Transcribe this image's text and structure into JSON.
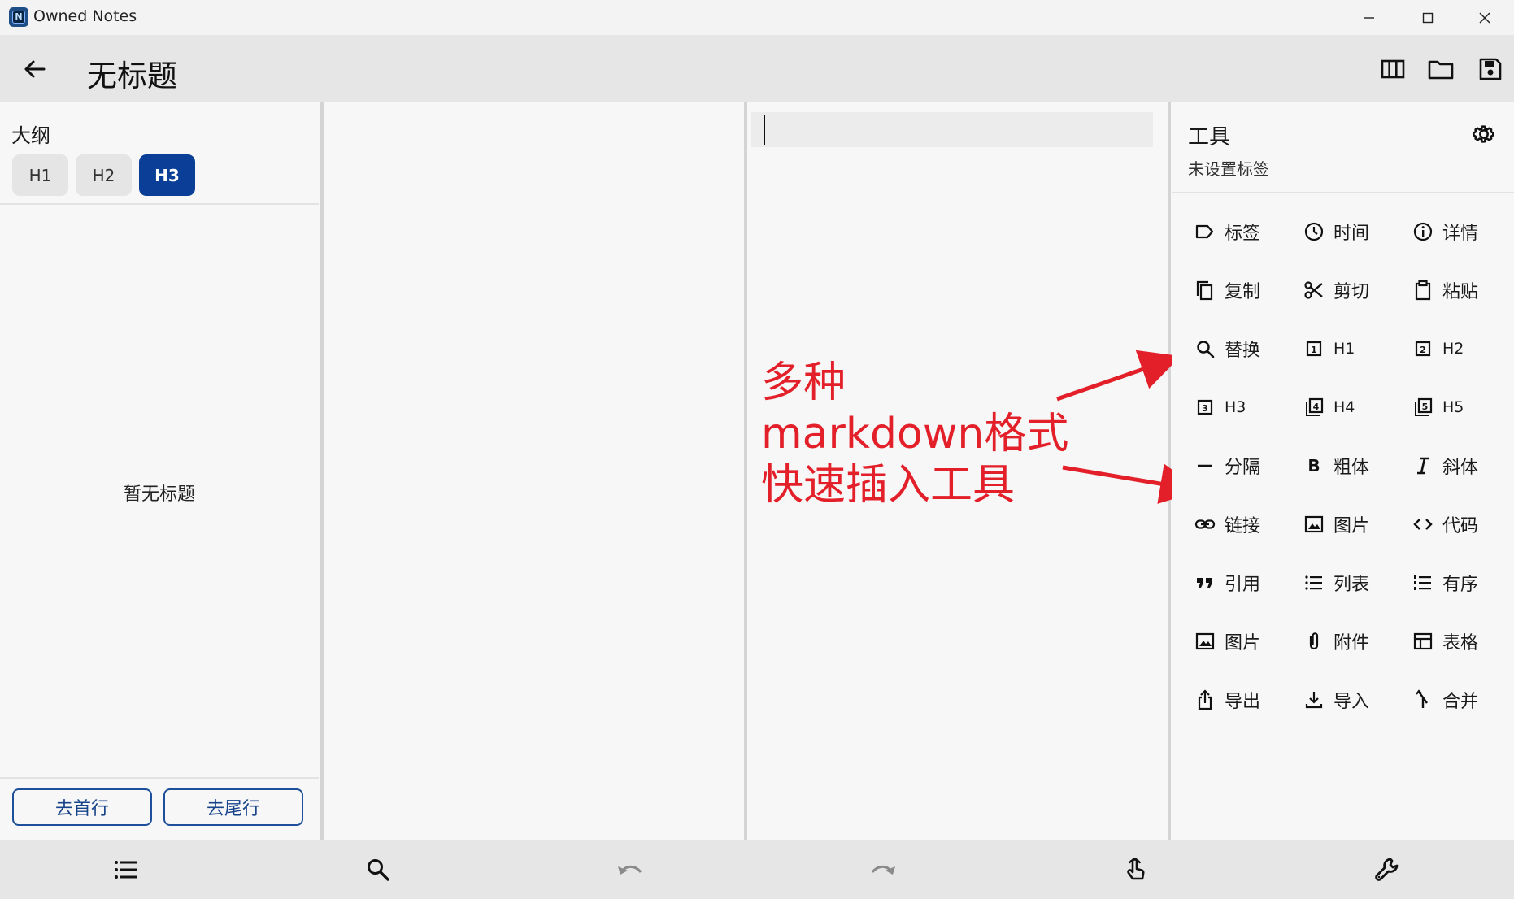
{
  "app": {
    "title": "Owned Notes",
    "logo_letter": "N"
  },
  "header": {
    "title": "无标题"
  },
  "outline": {
    "title": "大纲",
    "heading_buttons": [
      {
        "label": "H1",
        "active": false
      },
      {
        "label": "H2",
        "active": false
      },
      {
        "label": "H3",
        "active": true
      }
    ],
    "empty_text": "暂无标题",
    "goto_first": "去首行",
    "goto_last": "去尾行"
  },
  "annotation": {
    "lines": [
      "多种",
      "markdown格式",
      "快速插入工具"
    ],
    "color": "#e3202a"
  },
  "tools": {
    "title": "工具",
    "subtitle": "未设置标签",
    "items": [
      {
        "label": "标签",
        "icon": "label-icon"
      },
      {
        "label": "时间",
        "icon": "clock-icon"
      },
      {
        "label": "详情",
        "icon": "info-icon"
      },
      {
        "label": "复制",
        "icon": "copy-icon"
      },
      {
        "label": "剪切",
        "icon": "scissors-icon"
      },
      {
        "label": "粘贴",
        "icon": "clipboard-icon"
      },
      {
        "label": "替换",
        "icon": "search-icon"
      },
      {
        "label": "H1",
        "icon": "h1-box-icon"
      },
      {
        "label": "H2",
        "icon": "h2-box-icon"
      },
      {
        "label": "H3",
        "icon": "h3-box-icon"
      },
      {
        "label": "H4",
        "icon": "h4-box-icon"
      },
      {
        "label": "H5",
        "icon": "h5-box-icon"
      },
      {
        "label": "分隔",
        "icon": "horizontal-rule-icon"
      },
      {
        "label": "粗体",
        "icon": "bold-icon"
      },
      {
        "label": "斜体",
        "icon": "italic-icon"
      },
      {
        "label": "链接",
        "icon": "link-icon"
      },
      {
        "label": "图片",
        "icon": "image-icon"
      },
      {
        "label": "代码",
        "icon": "code-icon"
      },
      {
        "label": "引用",
        "icon": "quote-icon"
      },
      {
        "label": "列表",
        "icon": "bulleted-list-icon"
      },
      {
        "label": "有序",
        "icon": "numbered-list-icon"
      },
      {
        "label": "图片",
        "icon": "image-icon"
      },
      {
        "label": "附件",
        "icon": "attachment-icon"
      },
      {
        "label": "表格",
        "icon": "table-icon"
      },
      {
        "label": "导出",
        "icon": "export-icon"
      },
      {
        "label": "导入",
        "icon": "import-icon"
      },
      {
        "label": "合并",
        "icon": "merge-icon"
      }
    ]
  },
  "colors": {
    "accent": "#0b3f97",
    "outline_button_border": "#1d4f9a"
  }
}
